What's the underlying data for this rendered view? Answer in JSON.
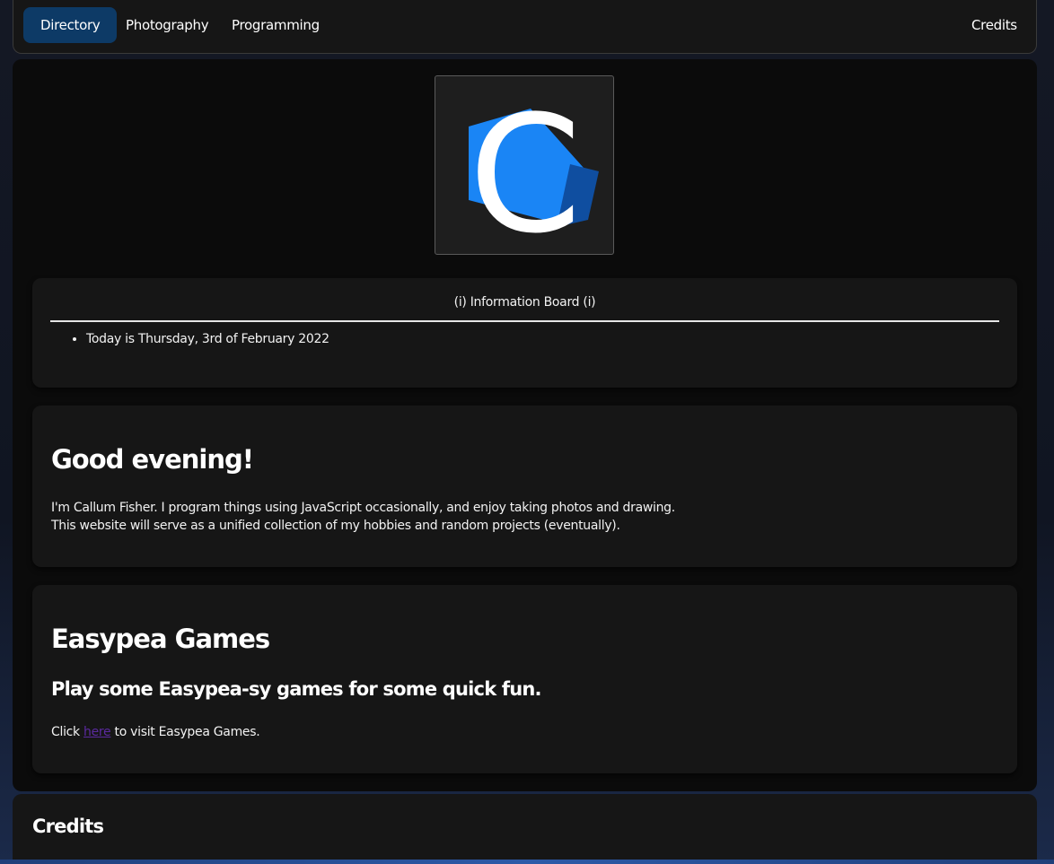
{
  "nav": {
    "items": [
      {
        "label": "Directory",
        "active": true
      },
      {
        "label": "Photography",
        "active": false
      },
      {
        "label": "Programming",
        "active": false
      }
    ],
    "right_item": {
      "label": "Credits"
    }
  },
  "logo": {
    "letter": "C",
    "colors": {
      "primary": "#1a85f5",
      "shadow": "#0f4ea0",
      "letter": "#ffffff",
      "background": "#1e1e1e"
    }
  },
  "info_board": {
    "title": "(i) Information Board (i)",
    "items": [
      "Today is Thursday, 3rd of February 2022"
    ]
  },
  "welcome": {
    "heading": "Good evening!",
    "line1": "I'm Callum Fisher. I program things using JavaScript occasionally, and enjoy taking photos and drawing.",
    "line2": "This website will serve as a unified collection of my hobbies and random projects (eventually)."
  },
  "games": {
    "heading": "Easypea Games",
    "subheading": "Play some Easypea-sy games for some quick fun.",
    "text_before": "Click ",
    "link_text": "here",
    "text_after": " to visit Easypea Games."
  },
  "credits": {
    "heading": "Credits"
  },
  "colors": {
    "nav_active": "#0d3a66",
    "card_bg": "#161616",
    "link": "#5b2aa0"
  }
}
